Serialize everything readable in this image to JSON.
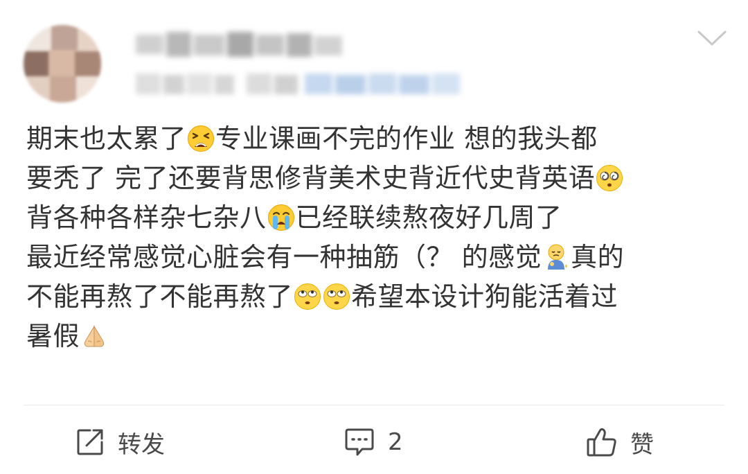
{
  "post": {
    "lines": [
      {
        "segments": [
          {
            "text": "期末也太累了"
          },
          {
            "emoji": "tired-face"
          },
          {
            "text": "专业课画不完的作业 想的我头都"
          }
        ]
      },
      {
        "segments": [
          {
            "text": "要秃了 完了还要背思修背美术史背近代史背英语"
          },
          {
            "emoji": "dizzy-face"
          }
        ]
      },
      {
        "segments": [
          {
            "text": "背各种各样杂七杂八"
          },
          {
            "emoji": "crying-face"
          },
          {
            "text": "已经联续熬夜好几周了"
          }
        ]
      },
      {
        "segments": [
          {
            "text": "最近经常感觉心脏会有一种抽筋（？ 的感觉"
          },
          {
            "emoji": "sleepy-person"
          },
          {
            "text": "真的"
          }
        ]
      },
      {
        "segments": [
          {
            "text": "不能再熬了不能再熬了"
          },
          {
            "emoji": "eye-roll-face"
          },
          {
            "emoji": "eye-roll-face"
          },
          {
            "text": "希望本设计狗能活着过"
          }
        ]
      },
      {
        "segments": [
          {
            "text": "暑假"
          },
          {
            "emoji": "folded-hands"
          }
        ]
      }
    ]
  },
  "header": {
    "more_icon": "chevron-down-icon"
  },
  "actions": {
    "repost_label": "转发",
    "comment_count": "2",
    "like_label": "赞"
  },
  "colors": {
    "text": "#333333",
    "icon": "#4a4a4a",
    "divider": "#e8e8e8",
    "meta_blue": "#c5d8ef"
  }
}
